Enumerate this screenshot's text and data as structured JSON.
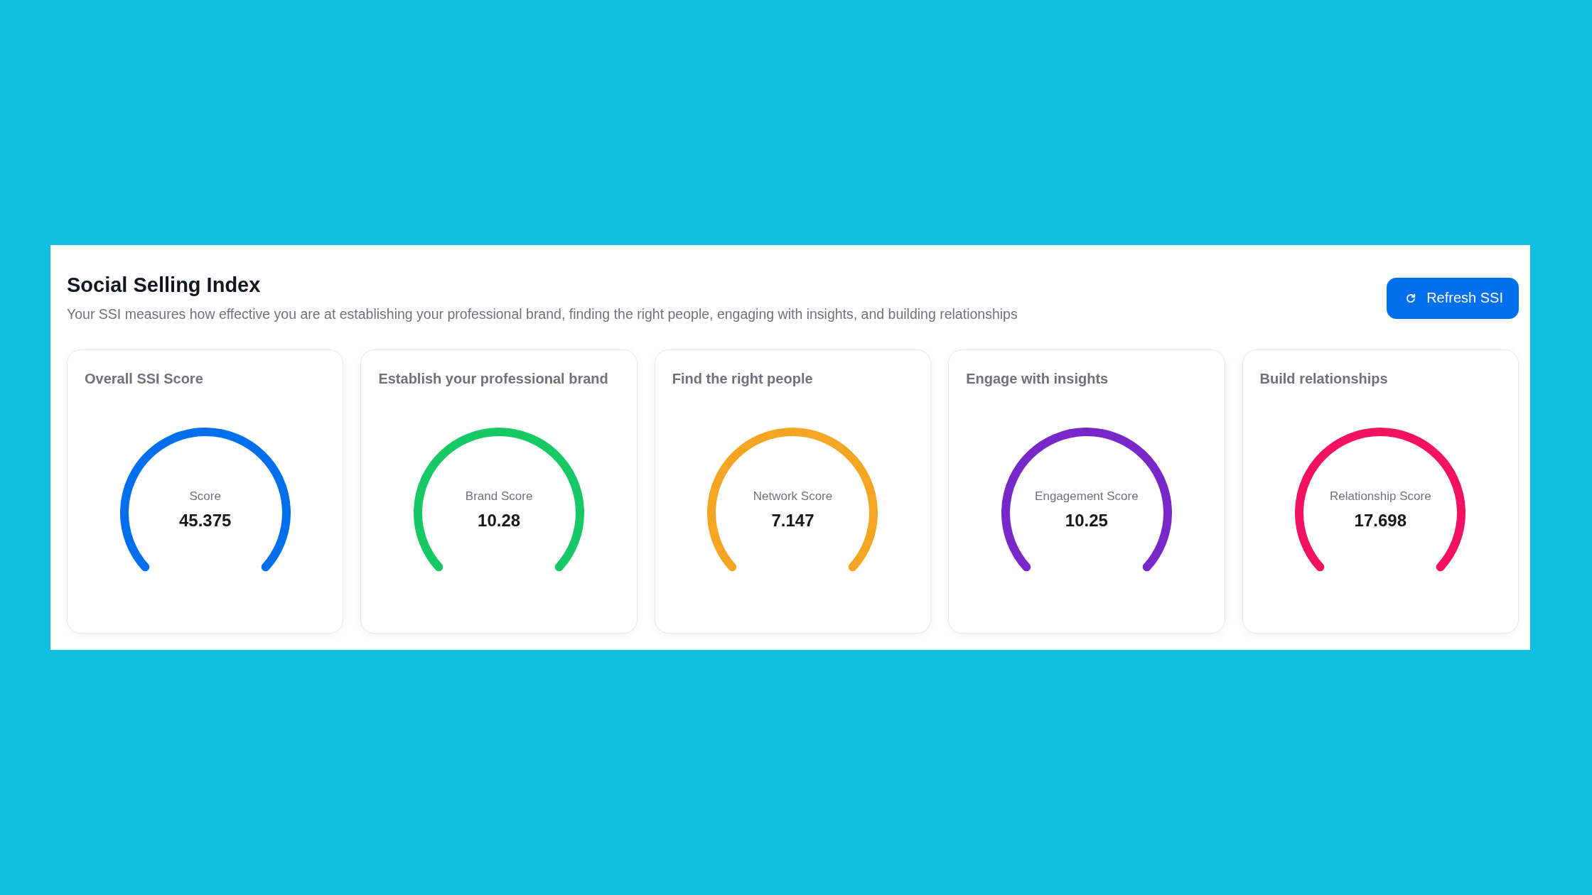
{
  "panel": {
    "title": "Social Selling Index",
    "description": "Your SSI measures how effective you are at establishing your professional brand, finding the right people, engaging with insights, and building relationships",
    "refresh_button": {
      "label": "Refresh SSI"
    }
  },
  "cards": [
    {
      "title": "Overall SSI Score",
      "label": "Score",
      "value": "45.375",
      "color": "#006fee"
    },
    {
      "title": "Establish your professional brand",
      "label": "Brand Score",
      "value": "10.28",
      "color": "#17c964"
    },
    {
      "title": "Find the right people",
      "label": "Network Score",
      "value": "7.147",
      "color": "#f5a524"
    },
    {
      "title": "Engage with insights",
      "label": "Engagement Score",
      "value": "10.25",
      "color": "#7828c8"
    },
    {
      "title": "Build relationships",
      "label": "Relationship Score",
      "value": "17.698",
      "color": "#f31260"
    }
  ]
}
